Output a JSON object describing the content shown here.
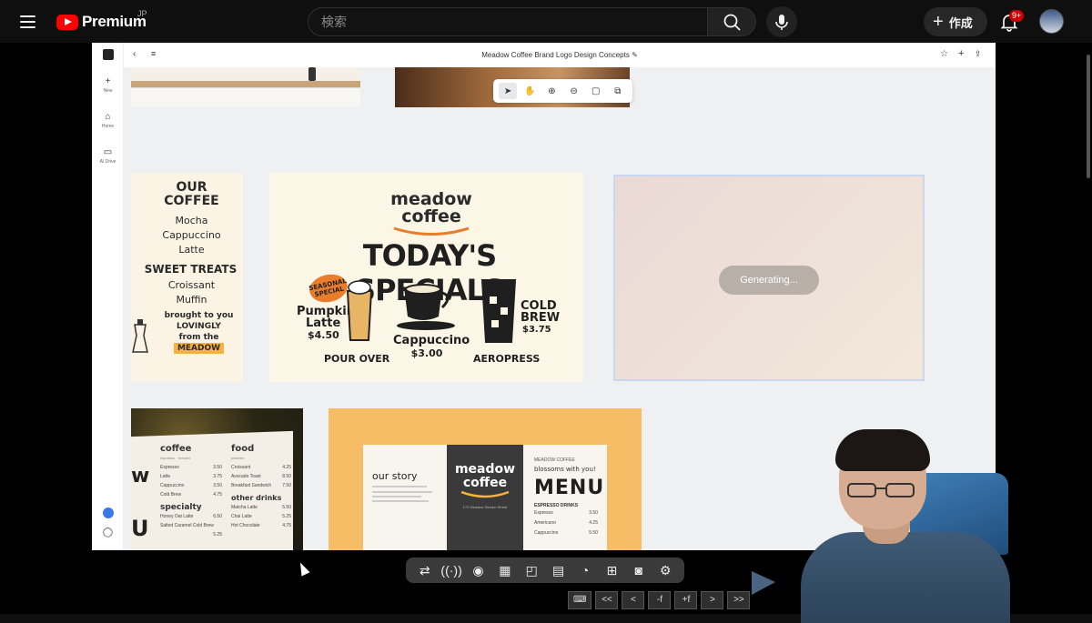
{
  "youtube": {
    "logo_text": "Premium",
    "region": "JP",
    "search_placeholder": "検索",
    "create_label": "作成",
    "notifications_badge": "9+"
  },
  "app": {
    "title": "Meadow Coffee Brand Logo Design Concepts",
    "rail": [
      {
        "label": "New",
        "icon": "plus-icon"
      },
      {
        "label": "Home",
        "icon": "home-icon"
      },
      {
        "label": "AI Drive",
        "icon": "folder-icon"
      }
    ],
    "generating_label": "Generating..."
  },
  "tiles": {
    "menu_left": {
      "heading": [
        "OUR",
        "COFFEE"
      ],
      "items": [
        "Mocha",
        "Cappuccino",
        "Latte"
      ],
      "sweet_heading": "SWEET TREATS",
      "sweet_items": [
        "Croissant",
        "Muffin"
      ],
      "tagline": [
        "brought to you",
        "LOVINGLY",
        "from the",
        "MEADOW"
      ]
    },
    "specials": {
      "brand": [
        "meadow",
        "coffee"
      ],
      "headline": "TODAY'S SPECIALS",
      "seasonal_badge": [
        "SEASONAL",
        "SPECIAL"
      ],
      "pumpkin": [
        "Pumpkin",
        "Latte"
      ],
      "pumpkin_price": "$4.50",
      "cappuccino": "Cappuccino",
      "cappuccino_price": "$3.00",
      "cold_brew": [
        "COLD",
        "BREW"
      ],
      "cold_brew_price": "$3.75",
      "footer": [
        "POUR OVER",
        "AEROPRESS"
      ]
    },
    "bokeh_menu": {
      "col1_head": "coffee",
      "col1_sub": "espresso · brewed",
      "col1": [
        [
          "Espresso",
          "3.50"
        ],
        [
          "Latte",
          "3.75"
        ],
        [
          "Cappuccino",
          "3.50"
        ],
        [
          "Cold Brew",
          "4.75"
        ]
      ],
      "col1b_head": "specialty",
      "col1b": [
        [
          "Honey Oat Latte",
          "6.50"
        ],
        [
          "Salted Caramel Cold Brew",
          "5.25"
        ]
      ],
      "col2_head": "food",
      "col2_sub": "pastries",
      "col2": [
        [
          "Croissant",
          "4.25"
        ],
        [
          "Avocado Toast",
          "8.50"
        ],
        [
          "Breakfast Sandwich",
          "7.50"
        ]
      ],
      "col2b_head": "other drinks",
      "col2b": [
        [
          "Matcha Latte",
          "5.50"
        ],
        [
          "Chai Latte",
          "5.25"
        ],
        [
          "Hot Chocolate",
          "4.75"
        ]
      ],
      "side_letters": [
        "w",
        "U"
      ]
    },
    "orange_menu": {
      "story_title": "our story",
      "brand": [
        "meadow",
        "coffee"
      ],
      "address": "172 Meadow Stream Street",
      "right_head": "MEADOW COFFEE",
      "right_tag": "blossoms with you!",
      "menu_title": "MENU",
      "espresso_head": "ESPRESSO DRINKS",
      "espresso": [
        [
          "Espresso",
          "3.50"
        ],
        [
          "Americano",
          "4.25"
        ],
        [
          "Cappuccino",
          "5.50"
        ]
      ]
    }
  },
  "player": {
    "buttons": [
      "loop-icon",
      "broadcast-icon",
      "eye-icon",
      "clapper-icon",
      "frame-icon",
      "film-icon",
      "speed-icon",
      "add-icon",
      "camera-icon",
      "gear-icon"
    ],
    "seek": [
      "<<",
      "<",
      "-f",
      "+f",
      ">",
      ">>"
    ]
  }
}
